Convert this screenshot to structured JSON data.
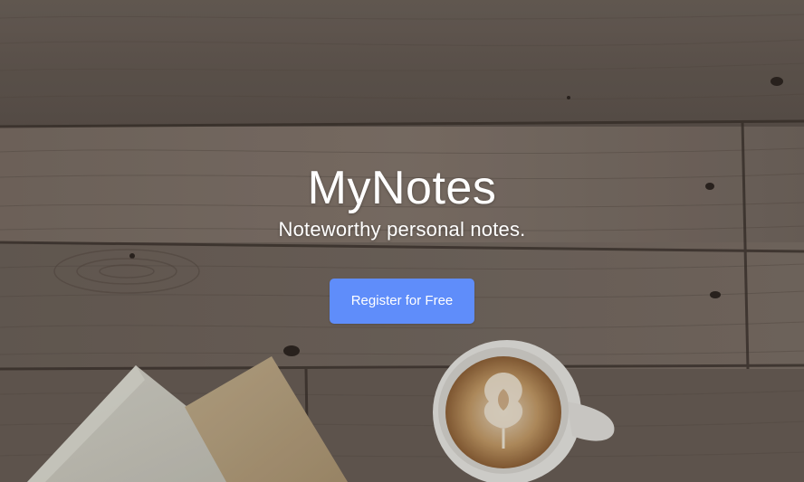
{
  "hero": {
    "title": "MyNotes",
    "subtitle": "Noteworthy personal notes.",
    "cta_label": "Register for Free"
  },
  "colors": {
    "accent": "#5f8dfa",
    "text": "#ffffff",
    "wood": "#7a6d63"
  },
  "icons": {
    "background": "wood-desk-coffee-photo"
  }
}
